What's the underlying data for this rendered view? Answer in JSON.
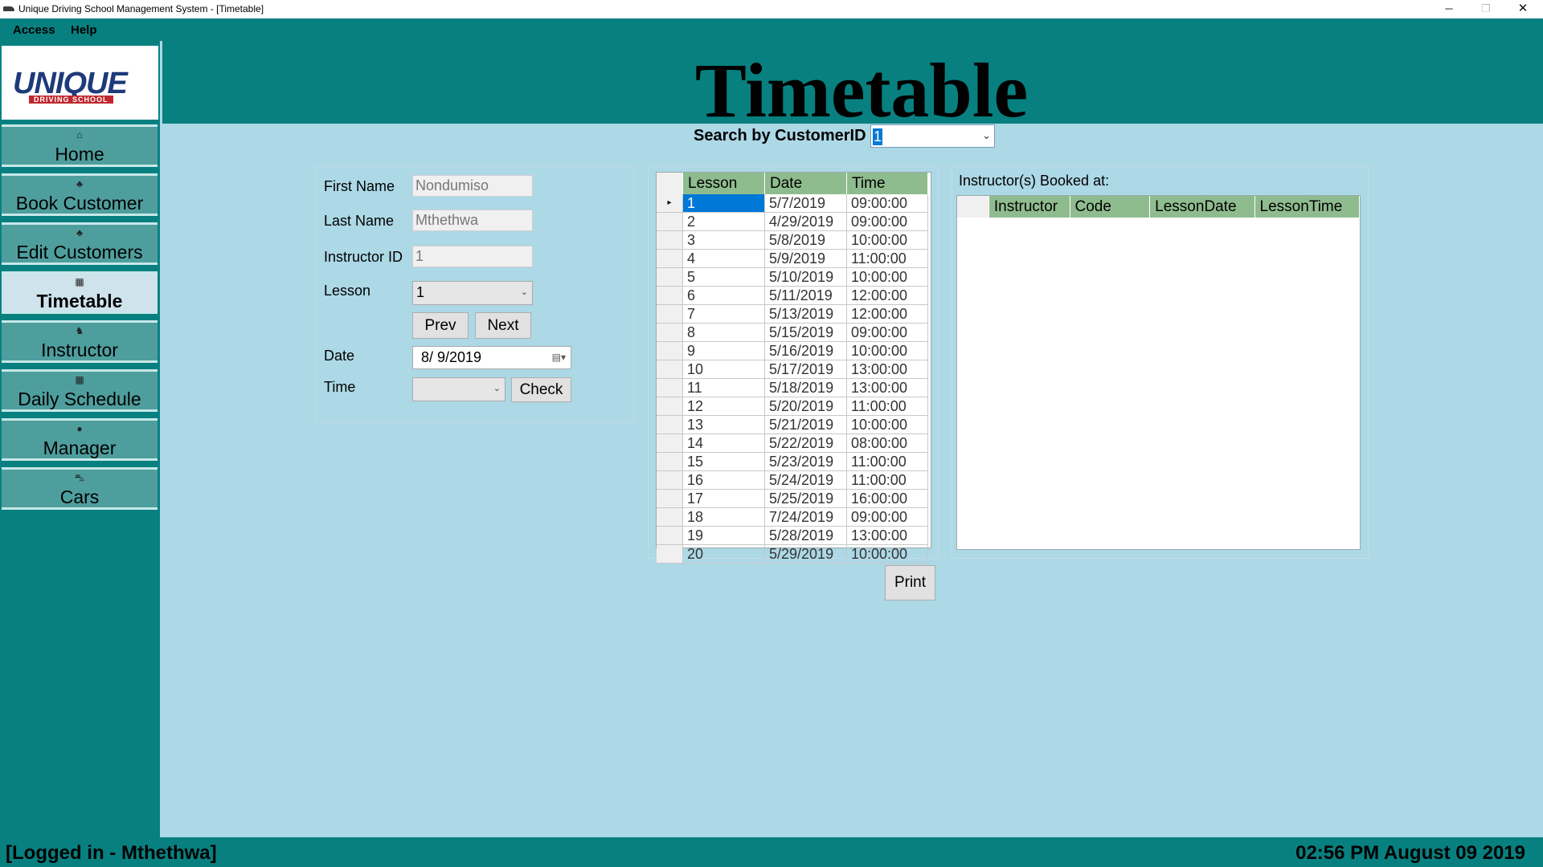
{
  "window": {
    "title": "Unique Driving School Management System - [Timetable]",
    "minimize": "─",
    "maximize": "❐",
    "close": "✕"
  },
  "menu": [
    "Access",
    "Help"
  ],
  "logo": {
    "text": "UNIQUE",
    "subtext": "DRIVING SCHOOL"
  },
  "sidebar": {
    "items": [
      {
        "label": "Home",
        "icon": "home-icon",
        "glyph": "⌂"
      },
      {
        "label": "Book Customer",
        "icon": "users-icon",
        "glyph": "♣"
      },
      {
        "label": "Edit Customers",
        "icon": "users-icon",
        "glyph": "♣"
      },
      {
        "label": "Timetable",
        "icon": "calendar-icon",
        "glyph": "▦"
      },
      {
        "label": "Instructor",
        "icon": "instructor-icon",
        "glyph": "♞"
      },
      {
        "label": "Daily Schedule",
        "icon": "schedule-icon",
        "glyph": "▦"
      },
      {
        "label": "Manager",
        "icon": "person-icon",
        "glyph": "●"
      },
      {
        "label": "Cars",
        "icon": "car-icon",
        "glyph": "⛍"
      }
    ],
    "active": "Timetable"
  },
  "header": {
    "title": "Timetable"
  },
  "search": {
    "label": "Search by CustomerID",
    "value": "1",
    "arrow": "⌄"
  },
  "form": {
    "first_name_label": "First Name",
    "first_name_value": "Nondumiso",
    "last_name_label": "Last Name",
    "last_name_value": "Mthethwa",
    "instructor_id_label": "Instructor ID",
    "instructor_id_value": "1",
    "lesson_label": "Lesson",
    "lesson_value": "1",
    "prev_label": "Prev",
    "next_label": "Next",
    "date_label": "Date",
    "date_value": "8/  9/2019",
    "time_label": "Time",
    "time_value": "",
    "check_label": "Check"
  },
  "lessons_grid": {
    "headers": [
      "Lesson",
      "Date",
      "Time"
    ],
    "rows": [
      [
        "1",
        "5/7/2019",
        "09:00:00"
      ],
      [
        "2",
        "4/29/2019",
        "09:00:00"
      ],
      [
        "3",
        "5/8/2019",
        "10:00:00"
      ],
      [
        "4",
        "5/9/2019",
        "11:00:00"
      ],
      [
        "5",
        "5/10/2019",
        "10:00:00"
      ],
      [
        "6",
        "5/11/2019",
        "12:00:00"
      ],
      [
        "7",
        "5/13/2019",
        "12:00:00"
      ],
      [
        "8",
        "5/15/2019",
        "09:00:00"
      ],
      [
        "9",
        "5/16/2019",
        "10:00:00"
      ],
      [
        "10",
        "5/17/2019",
        "13:00:00"
      ],
      [
        "11",
        "5/18/2019",
        "13:00:00"
      ],
      [
        "12",
        "5/20/2019",
        "11:00:00"
      ],
      [
        "13",
        "5/21/2019",
        "10:00:00"
      ],
      [
        "14",
        "5/22/2019",
        "08:00:00"
      ],
      [
        "15",
        "5/23/2019",
        "11:00:00"
      ],
      [
        "16",
        "5/24/2019",
        "11:00:00"
      ],
      [
        "17",
        "5/25/2019",
        "16:00:00"
      ],
      [
        "18",
        "7/24/2019",
        "09:00:00"
      ],
      [
        "19",
        "5/28/2019",
        "13:00:00"
      ],
      [
        "20",
        "5/29/2019",
        "10:00:00"
      ]
    ]
  },
  "booked": {
    "title": "Instructor(s) Booked at:",
    "headers": [
      "Instructor",
      "Code",
      "LessonDate",
      "LessonTime"
    ]
  },
  "print_label": "Print",
  "status": {
    "logged_in": "[Logged in -  Mthethwa]",
    "datetime": "02:56 PM  August  09  2019"
  },
  "colors": {
    "teal": "#088080",
    "content_bg": "#add8e6",
    "grid_header": "#8fbc8f",
    "selection": "#0078d7"
  }
}
